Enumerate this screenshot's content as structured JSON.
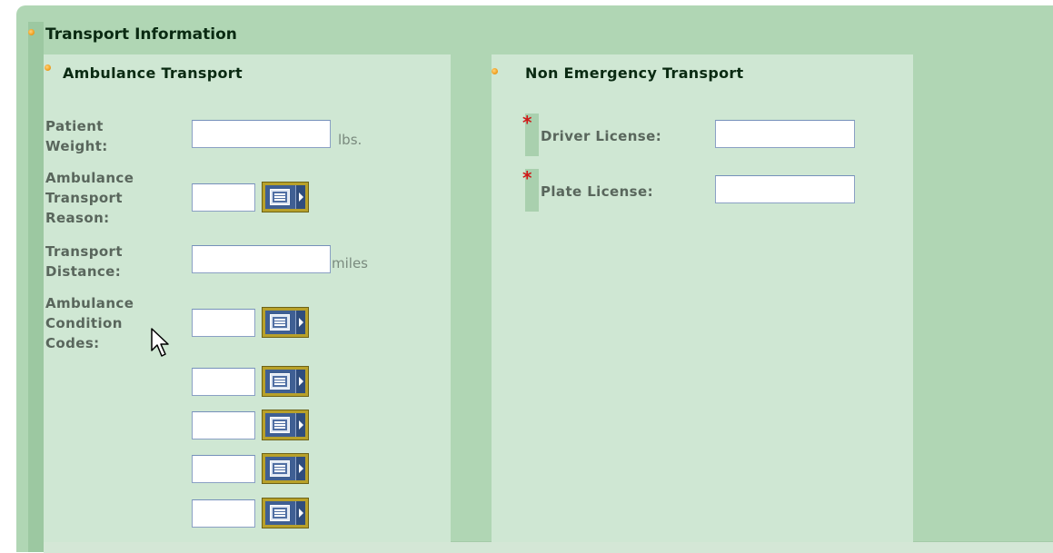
{
  "section": {
    "title": "Transport Information"
  },
  "ambulance": {
    "title": "Ambulance Transport",
    "patient_weight": {
      "label": "Patient Weight:",
      "value": "",
      "unit": "lbs."
    },
    "transport_reason": {
      "label": "Ambulance Transport Reason:",
      "value": ""
    },
    "transport_distance": {
      "label": "Transport Distance:",
      "value": "",
      "unit": "miles"
    },
    "condition_codes": {
      "label": "Ambulance Condition Codes:",
      "values": [
        "",
        "",
        "",
        "",
        ""
      ]
    }
  },
  "non_emergency": {
    "title": "Non Emergency Transport",
    "driver_license": {
      "label": "Driver License:",
      "value": "",
      "required_mark": "*"
    },
    "plate_license": {
      "label": "Plate License:",
      "value": "",
      "required_mark": "*"
    }
  },
  "icons": {
    "bullet": "orange-bullet-icon",
    "lookup": "lookup-list-icon",
    "cursor": "mouse-pointer-icon"
  },
  "colors": {
    "outer_background": "#b0d6b4",
    "panel_background": "#cfe7d3",
    "required_star": "#d01818",
    "button_border": "#b8a12a"
  }
}
